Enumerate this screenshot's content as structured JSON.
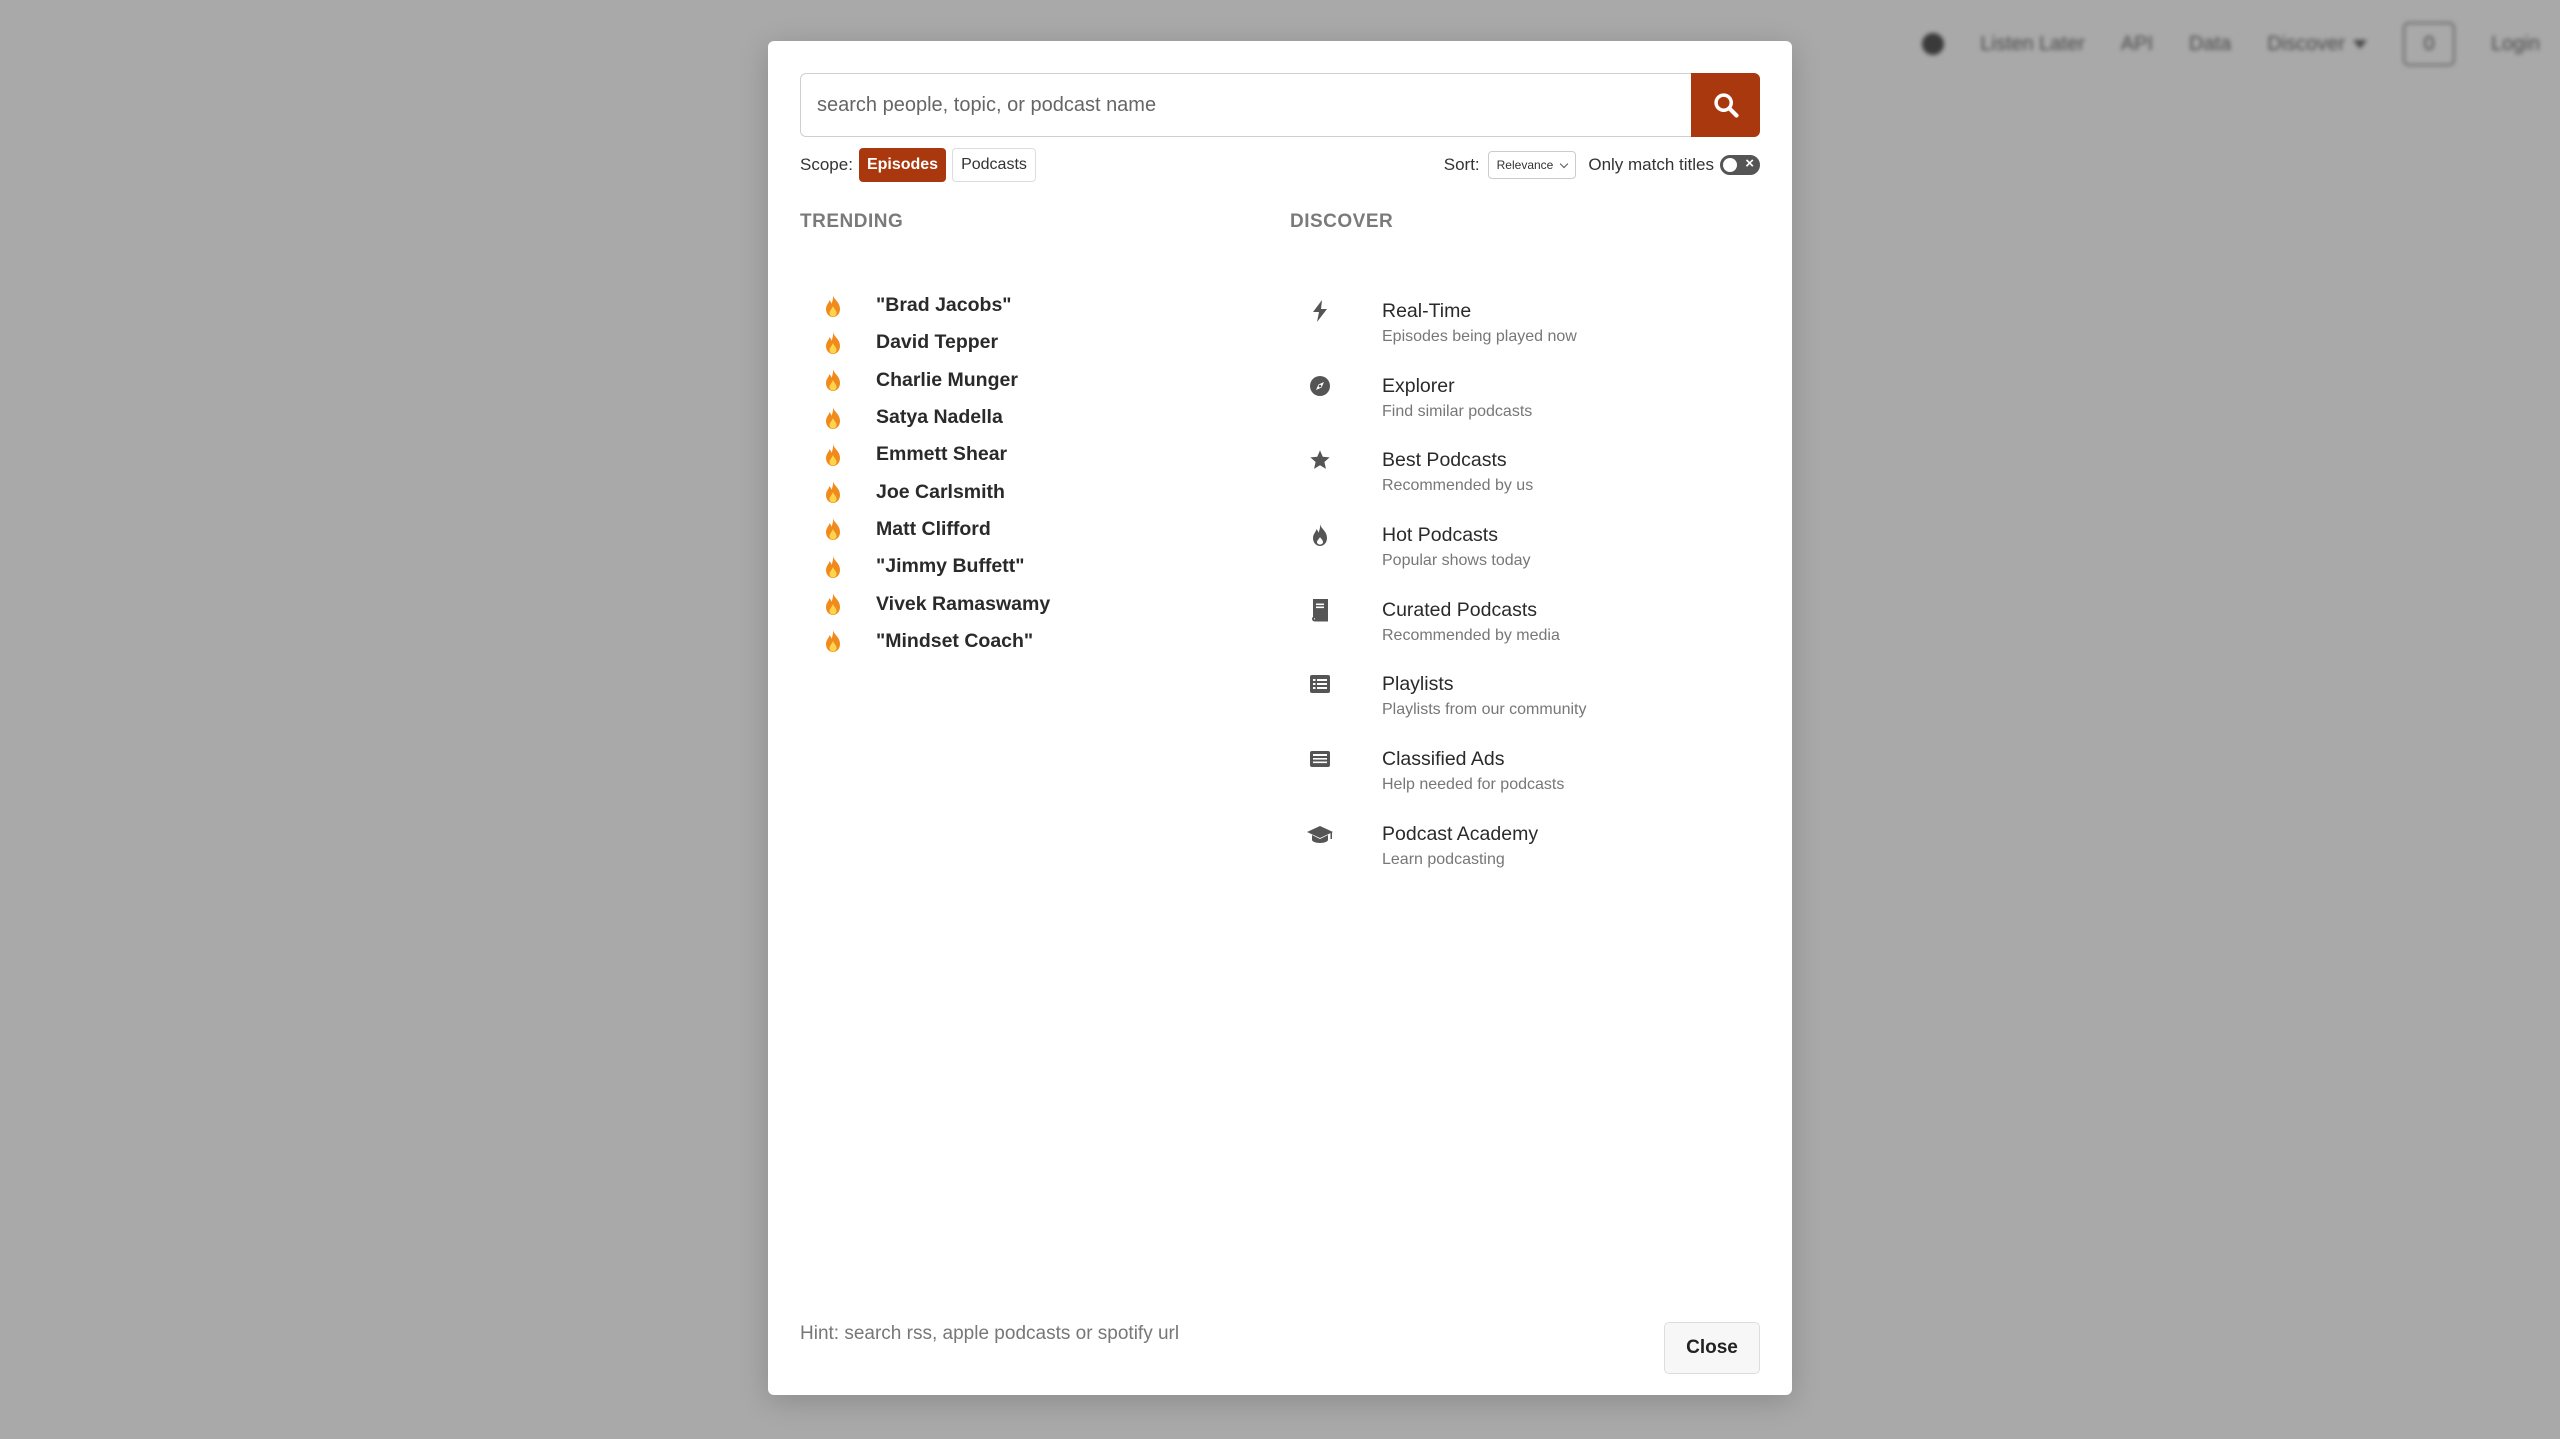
{
  "background_nav": {
    "items": [
      "Listen Later",
      "API",
      "Data",
      "Discover"
    ],
    "box_label": "0",
    "login": "Login"
  },
  "search": {
    "placeholder": "search people, topic, or podcast name",
    "button_icon": "search-icon"
  },
  "options": {
    "scope_label": "Scope:",
    "scopes": [
      "Episodes",
      "Podcasts"
    ],
    "active_scope": "Episodes",
    "sort_label": "Sort:",
    "sort_value": "Relevance",
    "only_match_titles_label": "Only match titles",
    "only_match_titles": false
  },
  "trending": {
    "title": "TRENDING",
    "icon": "fire-icon",
    "items": [
      "\"Brad Jacobs\"",
      "David Tepper",
      "Charlie Munger",
      "Satya Nadella",
      "Emmett Shear",
      "Joe Carlsmith",
      "Matt Clifford",
      "\"Jimmy Buffett\"",
      "Vivek Ramaswamy",
      "\"Mindset Coach\""
    ]
  },
  "discover": {
    "title": "DISCOVER",
    "items": [
      {
        "icon": "bolt-icon",
        "title": "Real-Time",
        "subtitle": "Episodes being played now"
      },
      {
        "icon": "compass-icon",
        "title": "Explorer",
        "subtitle": "Find similar podcasts"
      },
      {
        "icon": "star-icon",
        "title": "Best Podcasts",
        "subtitle": "Recommended by us"
      },
      {
        "icon": "flame-icon",
        "title": "Hot Podcasts",
        "subtitle": "Popular shows today"
      },
      {
        "icon": "book-icon",
        "title": "Curated Podcasts",
        "subtitle": "Recommended by media"
      },
      {
        "icon": "list-icon",
        "title": "Playlists",
        "subtitle": "Playlists from our community"
      },
      {
        "icon": "newspaper-icon",
        "title": "Classified Ads",
        "subtitle": "Help needed for podcasts"
      },
      {
        "icon": "graduation-cap-icon",
        "title": "Podcast Academy",
        "subtitle": "Learn podcasting"
      }
    ]
  },
  "footer": {
    "hint": "Hint: search rss, apple podcasts or spotify url",
    "close_label": "Close"
  },
  "colors": {
    "accent": "#a9380f",
    "overlay": "#a9a9a9"
  }
}
